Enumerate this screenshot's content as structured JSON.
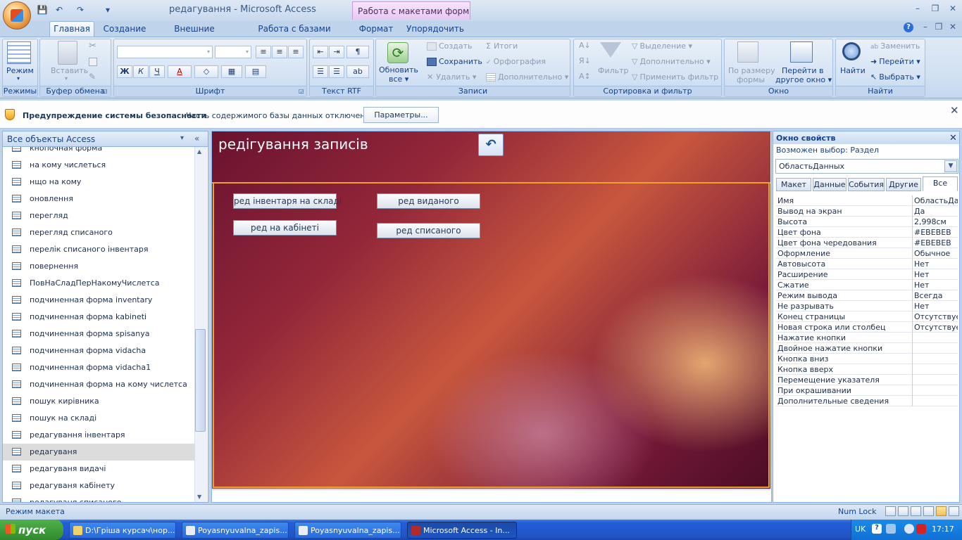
{
  "window": {
    "title": "редагування - Microsoft Access",
    "context_tab_header": "Работа с макетами форм",
    "controls": [
      "–",
      "❐",
      "✕"
    ]
  },
  "quick_access": [
    "💾",
    "↶",
    "↷",
    "▾"
  ],
  "ribbon": {
    "tabs": [
      "Главная",
      "Создание",
      "Внешние данные",
      "Работа с базами данных",
      "Формат",
      "Упорядочить"
    ],
    "active_tab": "Главная",
    "help": "?",
    "groups": {
      "views": {
        "label": "Режимы",
        "button": "Режим"
      },
      "clipboard": {
        "label": "Буфер обмена",
        "paste": "Вставить"
      },
      "font": {
        "label": "Шрифт",
        "bold": "Ж",
        "italic": "К",
        "underline": "Ч",
        "fontcolor": "A"
      },
      "rtf": {
        "label": "Текст RTF"
      },
      "records": {
        "label": "Записи",
        "refresh_line1": "Обновить",
        "refresh_line2": "все ▾",
        "create": "Создать",
        "save": "Сохранить",
        "delete": "Удалить ▾",
        "totals": "Итоги",
        "spelling": "Орфография",
        "more": "Дополнительно ▾"
      },
      "sort": {
        "label": "Сортировка и фильтр",
        "filter": "Фильтр",
        "selection": "Выделение ▾",
        "advanced": "Дополнительно ▾",
        "toggle": "Применить фильтр"
      },
      "window": {
        "label": "Окно",
        "fit_line1": "По размеру",
        "fit_line2": "формы",
        "switch_line1": "Перейти в",
        "switch_line2": "другое окно ▾"
      },
      "find": {
        "label": "Найти",
        "find": "Найти",
        "replace": "Заменить",
        "goto": "Перейти ▾",
        "select": "Выбрать ▾"
      }
    }
  },
  "security": {
    "title": "Предупреждение системы безопасности",
    "message": "Часть содержимого базы данных отключено",
    "button": "Параметры..."
  },
  "nav": {
    "header": "Все объекты Access",
    "dropdown": "▾",
    "collapse": "«",
    "items": [
      "кнопочная форма",
      "на кому числеться",
      "нщо на кому",
      "оновлення",
      "перегляд",
      "перегляд списаного",
      "перелік списаного інвентаря",
      "повернення",
      "ПовНаСладПерНакомуЧислетса",
      "подчиненная форма inventary",
      "подчиненная форма kabineti",
      "подчиненная форма spisanya",
      "подчиненная форма vidacha",
      "подчиненная форма vidacha1",
      "подчиненная форма на кому числетса",
      "пошук кирівника",
      "пошук на складі",
      "редагування інвентаря",
      "редагуваня",
      "редагуваня видачі",
      "редагуваня кабінету",
      "редагуваня списаного"
    ],
    "selected_index": 18
  },
  "form": {
    "title": "редігування записів",
    "undo_icon": "↶",
    "buttons": {
      "inventory": "ред інвентаря на складі",
      "issued": "ред виданого",
      "cabinet": "ред на кабінеті",
      "written_off": "ред списаного"
    }
  },
  "properties": {
    "title": "Окно свойств",
    "close": "✕",
    "selection_label": "Возможен выбор:  Раздел",
    "selected_object": "ОбластьДанных",
    "tabs": [
      "Макет",
      "Данные",
      "События",
      "Другие",
      "Все"
    ],
    "active_tab": "Все",
    "rows": [
      {
        "name": "Имя",
        "value": "ОбластьДанных"
      },
      {
        "name": "Вывод на экран",
        "value": "Да"
      },
      {
        "name": "Высота",
        "value": "2,998см"
      },
      {
        "name": "Цвет фона",
        "value": "#EBEBEB"
      },
      {
        "name": "Цвет фона чередования",
        "value": "#EBEBEB"
      },
      {
        "name": "Оформление",
        "value": "Обычное"
      },
      {
        "name": "Автовысота",
        "value": "Нет"
      },
      {
        "name": "Расширение",
        "value": "Нет"
      },
      {
        "name": "Сжатие",
        "value": "Нет"
      },
      {
        "name": "Режим вывода",
        "value": "Всегда"
      },
      {
        "name": "Не разрывать",
        "value": "Нет"
      },
      {
        "name": "Конец страницы",
        "value": "Отсутствует"
      },
      {
        "name": "Новая строка или столбец",
        "value": "Отсутствует"
      },
      {
        "name": "Нажатие кнопки",
        "value": ""
      },
      {
        "name": "Двойное нажатие кнопки",
        "value": ""
      },
      {
        "name": "Кнопка вниз",
        "value": ""
      },
      {
        "name": "Кнопка вверх",
        "value": ""
      },
      {
        "name": "Перемещение указателя",
        "value": ""
      },
      {
        "name": "При окрашивании",
        "value": ""
      },
      {
        "name": "Дополнительные сведения",
        "value": ""
      }
    ]
  },
  "status": {
    "mode": "Режим макета",
    "numlock": "Num Lock"
  },
  "taskbar": {
    "start": "пуск",
    "tasks": [
      "D:\\Гріша курсач\\нор...",
      "Poyasnyuvalna_zapis...",
      "Poyasnyuvalna_zapis...",
      "Microsoft Access - In..."
    ],
    "active_task": 3,
    "lang": "UK",
    "time": "17:17"
  }
}
